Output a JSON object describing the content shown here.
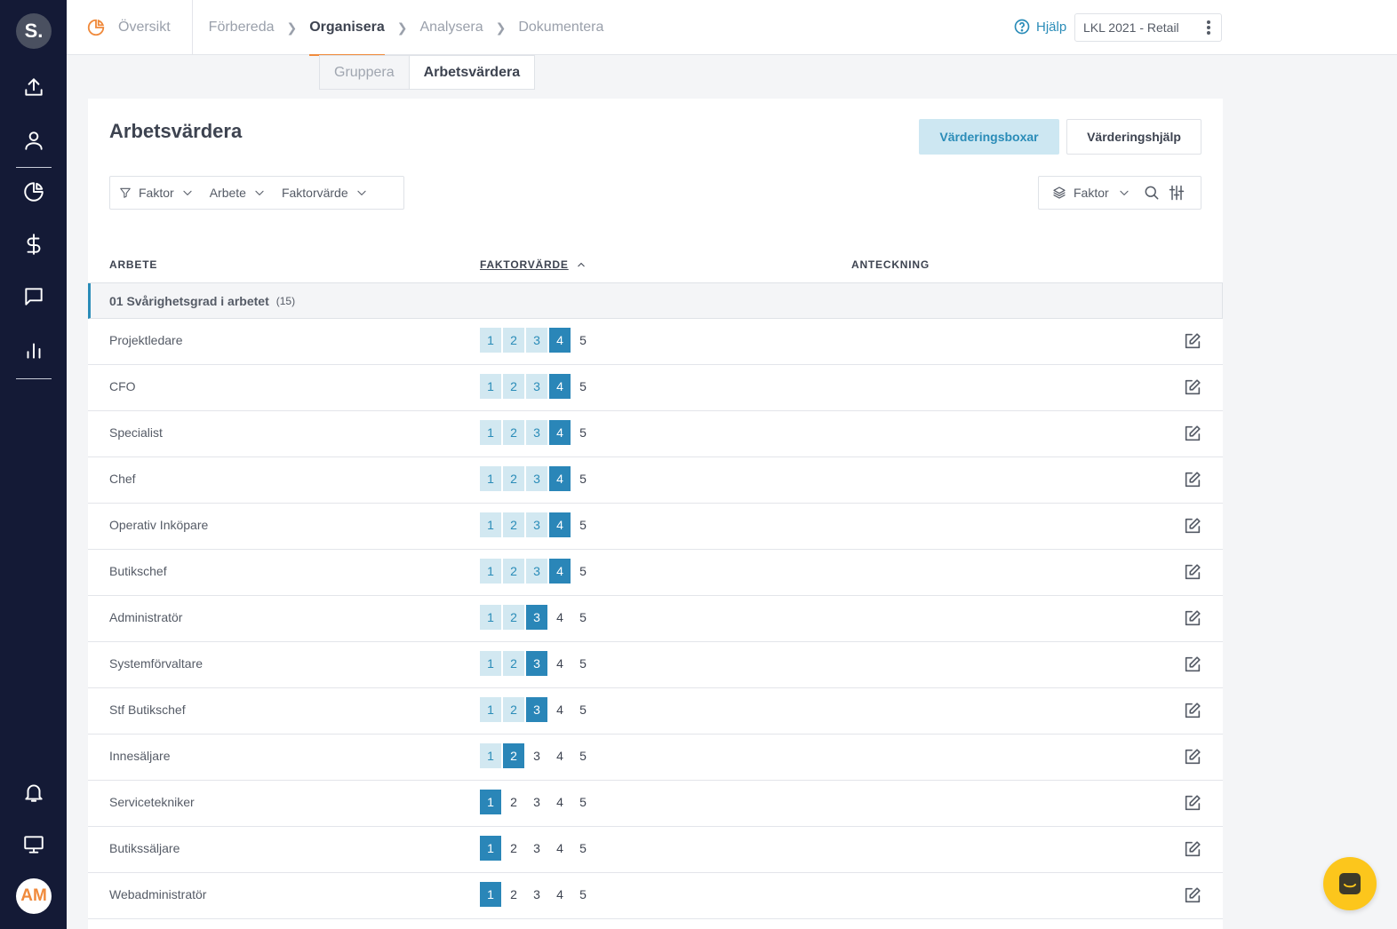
{
  "sidebar": {
    "logo": "S.",
    "avatar": "AM",
    "icons": [
      "upload-icon",
      "user-icon",
      "pie-chart-icon",
      "dollar-icon",
      "chat-icon",
      "bar-chart-icon",
      "bell-icon",
      "monitor-icon"
    ]
  },
  "nav": {
    "overview": "Översikt",
    "steps": [
      "Förbereda",
      "Organisera",
      "Analysera",
      "Dokumentera"
    ],
    "active_step": "Organisera"
  },
  "header": {
    "help": "Hjälp",
    "project": "LKL 2021 - Retail"
  },
  "subtabs": [
    "Gruppera",
    "Arbetsvärdera"
  ],
  "page": {
    "title": "Arbetsvärdera",
    "primary_button": "Värderingsboxar",
    "secondary_button": "Värderingshjälp"
  },
  "filters": [
    "Faktor",
    "Arbete",
    "Faktorvärde"
  ],
  "view": {
    "label": "Faktor"
  },
  "table": {
    "headers": {
      "job": "ARBETE",
      "value": "FAKTORVÄRDE",
      "note": "ANTECKNING"
    },
    "group": {
      "name": "01 Svårighetsgrad i arbetet",
      "count": "(15)"
    },
    "scale": [
      "1",
      "2",
      "3",
      "4",
      "5"
    ],
    "rows": [
      {
        "name": "Projektledare",
        "value": 4
      },
      {
        "name": "CFO",
        "value": 4
      },
      {
        "name": "Specialist",
        "value": 4
      },
      {
        "name": "Chef",
        "value": 4
      },
      {
        "name": "Operativ Inköpare",
        "value": 4
      },
      {
        "name": "Butikschef",
        "value": 4
      },
      {
        "name": "Administratör",
        "value": 3
      },
      {
        "name": "Systemförvaltare",
        "value": 3
      },
      {
        "name": "Stf Butikschef",
        "value": 3
      },
      {
        "name": "Innesäljare",
        "value": 2
      },
      {
        "name": "Servicetekniker",
        "value": 1
      },
      {
        "name": "Butikssäljare",
        "value": 1
      },
      {
        "name": "Webadministratör",
        "value": 1
      }
    ]
  },
  "colors": {
    "accent": "#2a86b8",
    "accent_light": "#d2e8f1",
    "brand_orange": "#f08a3c",
    "sidebar": "#141a36",
    "chat": "#fcc61c"
  }
}
